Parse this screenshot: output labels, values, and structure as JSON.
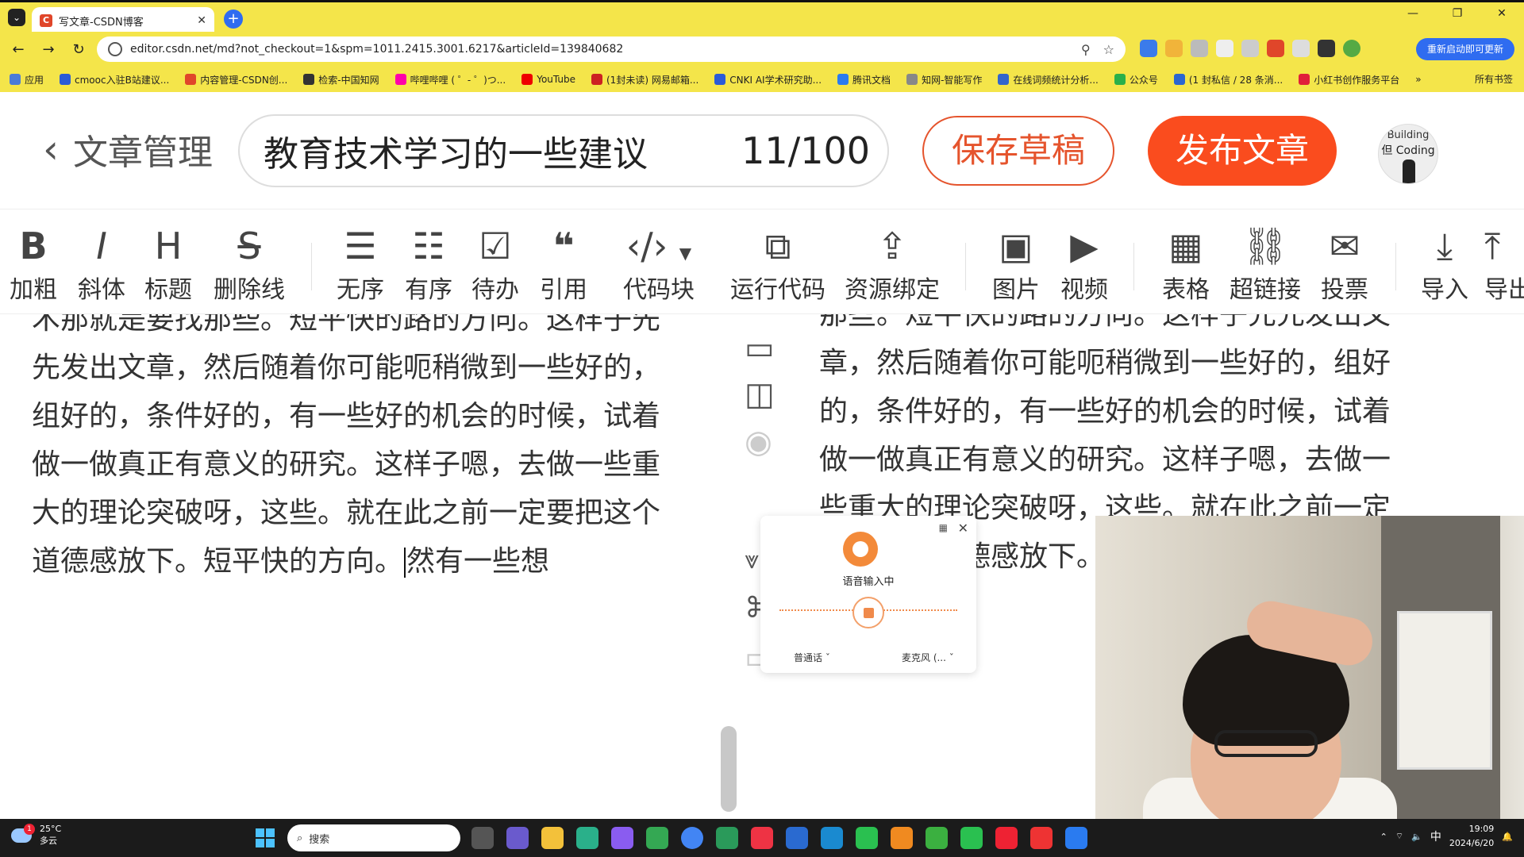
{
  "browser": {
    "tab_title": "写文章-CSDN博客",
    "tab_favicon": "C",
    "url": "editor.csdn.net/md?not_checkout=1&spm=1011.2415.3001.6217&articleId=139840682",
    "restart_label": "重新启动即可更新",
    "bookmarks": [
      {
        "label": "应用",
        "color": "#4a7bd8"
      },
      {
        "label": "cmooc入驻B站建议...",
        "color": "#2a5bd7"
      },
      {
        "label": "内容管理-CSDN创...",
        "color": "#e0462a"
      },
      {
        "label": "检索-中国知网",
        "color": "#333333"
      },
      {
        "label": "哔哩哔哩 ( ゜- ゜)つ...",
        "color": "#f0a"
      },
      {
        "label": "YouTube",
        "color": "#e00"
      },
      {
        "label": "(1封未读) 网易邮箱...",
        "color": "#c22"
      },
      {
        "label": "CNKI AI学术研究助...",
        "color": "#2a5bd7"
      },
      {
        "label": "腾讯文档",
        "color": "#2a7bf0"
      },
      {
        "label": "知网-智能写作",
        "color": "#888"
      },
      {
        "label": "在线词频统计分析...",
        "color": "#3366cc"
      },
      {
        "label": "公众号",
        "color": "#2ab04a"
      },
      {
        "label": "(1 封私信 / 28 条消...",
        "color": "#2a66d0"
      },
      {
        "label": "小红书创作服务平台",
        "color": "#e0203a"
      }
    ],
    "bookmarks_more": "»",
    "all_bookmarks": "所有书签"
  },
  "editor": {
    "back_label": "文章管理",
    "title": "教育技术学习的一些建议",
    "title_count": "11/100",
    "save_draft": "保存草稿",
    "publish": "发布文章",
    "avatar_line1": "Building",
    "avatar_line2": "但 Coding"
  },
  "toolbar": {
    "bold": "加粗",
    "italic": "斜体",
    "heading": "标题",
    "strike": "删除线",
    "unordered": "无序",
    "ordered": "有序",
    "todo": "待办",
    "quote": "引用",
    "codeblock": "代码块",
    "run_code": "运行代码",
    "resource_bind": "资源绑定",
    "image": "图片",
    "video": "视频",
    "table": "表格",
    "link": "超链接",
    "vote": "投票",
    "import": "导入",
    "export": "导出"
  },
  "content": {
    "left_lines": [
      "术那就是要找那些。短平快的路的方向。这样子先",
      "先发出文章，然后随着你可能呃稍微到一些好的，",
      "组好的，条件好的，有一些好的机会的时候，试着",
      "做一做真正有意义的研究。这样子嗯，去做一些重",
      "大的理论突破呀，这些。就在此之前一定要把这个"
    ],
    "left_last_before": "道德感放下。短平快的方向。",
    "left_last_after": "然有一些想",
    "right_lines": [
      "那些。短平快的路的方向。这样子先先发出文",
      "章，然后随着你可能呃稍微到一些好的，组好",
      "的，条件好的，有一些好的机会的时候，试着",
      "做一做真正有意义的研究。这样子嗯，去做一",
      "些重大的理论突破呀，这些。就在此之前一定",
      "要把这个道德感放下。"
    ]
  },
  "voice": {
    "status": "语音输入中",
    "language": "普通话",
    "mic": "麦克风 (..."
  },
  "taskbar": {
    "temp": "25°C",
    "weather": "多云",
    "badge": "1",
    "search_placeholder": "搜索",
    "ime": "中",
    "time": "19:09",
    "date": "2024/6/20"
  },
  "colors": {
    "chrome": "#f4e54a",
    "publish": "#fa4c1e",
    "accent": "#2f6cf0"
  }
}
